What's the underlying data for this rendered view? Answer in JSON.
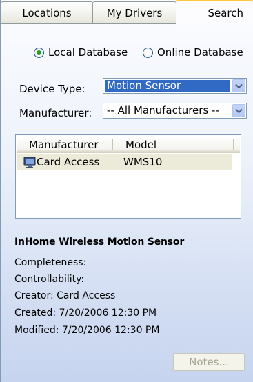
{
  "tabs": [
    {
      "label": "Locations"
    },
    {
      "label": "My Drivers"
    },
    {
      "label": "Search",
      "active": true
    }
  ],
  "source": {
    "options": [
      {
        "label": "Local Database",
        "checked": true
      },
      {
        "label": "Online Database",
        "checked": false
      }
    ]
  },
  "device_type": {
    "label": "Device Type:",
    "value": "Motion Sensor"
  },
  "manufacturer": {
    "label": "Manufacturer:",
    "value": "-- All Manufacturers --"
  },
  "results": {
    "columns": [
      "Manufacturer",
      "Model"
    ],
    "rows": [
      {
        "manufacturer": "Card Access",
        "model": "WMS10",
        "icon": "monitor-icon"
      }
    ]
  },
  "details": {
    "title": "InHome Wireless Motion Sensor",
    "completeness": "Completeness:",
    "controllability": "Controllability:",
    "creator": "Creator: Card Access",
    "created": "Created: 7/20/2006 12:30 PM",
    "modified": "Modified: 7/20/2006 12:30 PM"
  },
  "buttons": {
    "notes": "Notes..."
  },
  "colors": {
    "selection": "#316ac5",
    "radio_checked": "#21a121",
    "row_highlight": "#ecead9",
    "tab_active_accent": "#ffc83c"
  }
}
